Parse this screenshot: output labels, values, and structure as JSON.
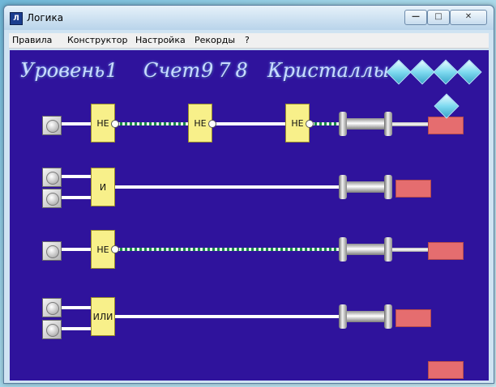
{
  "window": {
    "title": "Логика",
    "icon_label": "Л"
  },
  "menu": [
    "Правила",
    "Конструктор",
    "Настройка",
    "Рекорды",
    "?"
  ],
  "hud": {
    "level_label": "Уровень",
    "level_value": "1",
    "score_label": "Счет",
    "score_value": "978",
    "crystals_label": "Кристаллы",
    "crystal_count": 4
  },
  "circuits": [
    {
      "gates": [
        "НЕ",
        "НЕ",
        "НЕ"
      ]
    },
    {
      "gates": [
        "И"
      ]
    },
    {
      "gates": [
        "НЕ"
      ]
    },
    {
      "gates": [
        "ИЛИ"
      ]
    }
  ],
  "colors": {
    "board": "#2f139c",
    "gate": "#f8f08a",
    "lamp": "#e56d6f",
    "wire_active": "#1c8c4a"
  }
}
